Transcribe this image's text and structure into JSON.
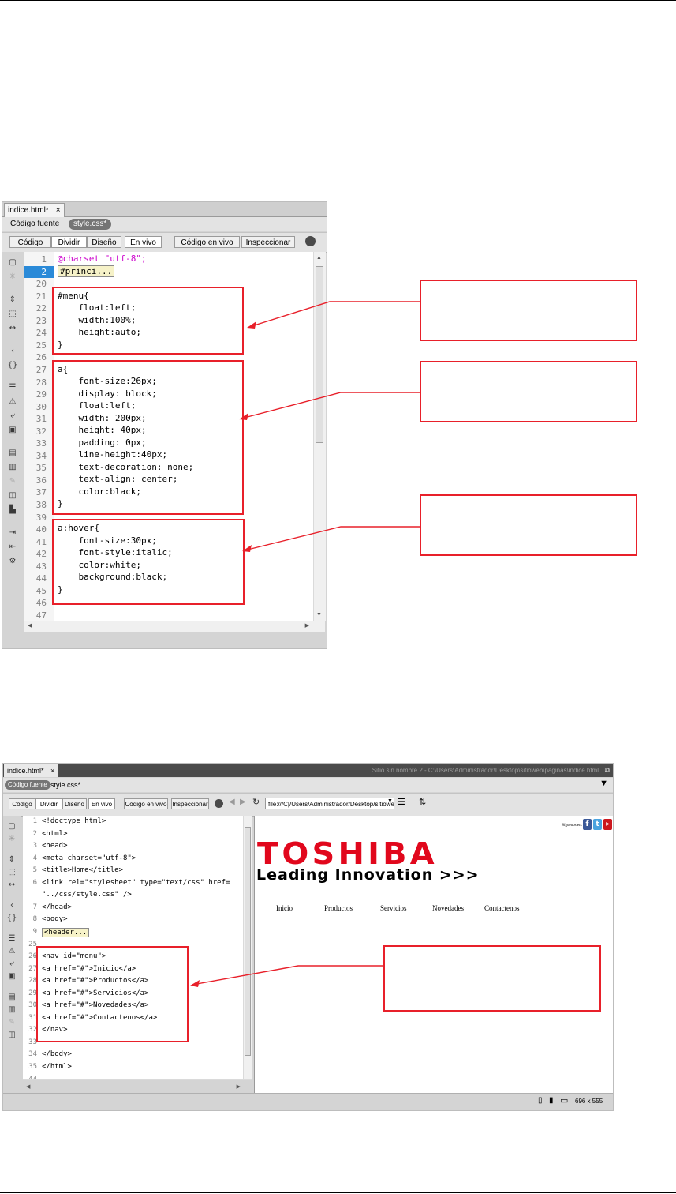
{
  "window1": {
    "tab": {
      "label": "indice.html*",
      "close": "×"
    },
    "related": {
      "source_label": "Código fuente",
      "file_pill": "style.css*"
    },
    "toolbar": {
      "codigo": "Código",
      "dividir": "Dividir",
      "diseno": "Diseño",
      "en_vivo": "En vivo",
      "codigo_en_vivo": "Código en vivo",
      "inspeccionar": "Inspeccionar"
    },
    "gutter": [
      "1",
      "2",
      "20",
      "21",
      "22",
      "23",
      "24",
      "25",
      "26",
      "27",
      "28",
      "29",
      "30",
      "31",
      "32",
      "33",
      "34",
      "35",
      "36",
      "37",
      "38",
      "39",
      "40",
      "41",
      "42",
      "43",
      "44",
      "45",
      "46",
      "47"
    ],
    "current_line": "2",
    "lines": {
      "l1_a": "@charset",
      "l1_b": " \"utf-8\";",
      "l2": "#princi...",
      "l21": "#menu{",
      "l22": "    float:left;",
      "l23": "    width:100%;",
      "l24": "    height:auto;",
      "l25": "}",
      "l27": "a{",
      "l28": "    font-size:26px;",
      "l29": "    display: block;",
      "l30": "    float:left;",
      "l31": "    width: 200px;",
      "l32": "    height: 40px;",
      "l33": "    padding: 0px;",
      "l34": "    line-height:40px;",
      "l35": "    text-decoration: none;",
      "l36": "    text-align: center;",
      "l37": "    color:black;",
      "l38": "}",
      "l40": "a:hover{",
      "l41": "    font-size:30px;",
      "l42": "    font-style:italic;",
      "l43": "    color:white;",
      "l44": "    background:black;",
      "l45": "}"
    }
  },
  "window2": {
    "tab": {
      "label": "indice.html*",
      "close": "×"
    },
    "title_path": "Sitio sin nombre 2 - C:\\Users\\Administrador\\Desktop\\sitioweb\\paginas\\indice.html",
    "related": {
      "source_pill": "Código fuente",
      "file_label": "style.css*"
    },
    "toolbar": {
      "codigo": "Código",
      "dividir": "Dividir",
      "diseno": "Diseño",
      "en_vivo": "En vivo",
      "codigo_en_vivo": "Código en vivo",
      "inspeccionar": "Inspeccionar",
      "address": "file:///C|/Users/Administrador/Desktop/sitiowel"
    },
    "gutter": [
      "1",
      "2",
      "3",
      "4",
      "5",
      "6",
      "",
      "7",
      "8",
      "9",
      "25",
      "26",
      "27",
      "28",
      "29",
      "30",
      "31",
      "32",
      "33",
      "34",
      "35",
      "44"
    ],
    "lines": [
      "<!doctype html>",
      "<html>",
      "<head>",
      "<meta charset=\"utf-8\">",
      "<title>Home</title>",
      "<link rel=\"stylesheet\" type=\"text/css\" href=",
      "\"../css/style.css\" />",
      "</head>",
      "<body>",
      "<header...",
      "",
      "<nav id=\"menu\">",
      "<a href=\"#\">Inicio</a>",
      "<a href=\"#\">Productos</a>",
      "<a href=\"#\">Servicios</a>",
      "<a href=\"#\">Novedades</a>",
      "<a href=\"#\">Contactenos</a>",
      "</nav>",
      "",
      "</body>",
      "</html>",
      ""
    ],
    "live": {
      "follow_label": "Síguenos en:",
      "logo_text": "TOSHIBA",
      "tagline": "Leading Innovation >>>",
      "menu": [
        "Inicio",
        "Productos",
        "Servicios",
        "Novedades",
        "Contactenos"
      ],
      "social": {
        "facebook": "f",
        "twitter": "t",
        "youtube": "▶"
      }
    },
    "status": {
      "size": "696 x 555"
    }
  },
  "colors": {
    "annotation_red": "#e8202a",
    "toshiba_red": "#e1071c",
    "line_highlight": "#2a8ad8"
  }
}
